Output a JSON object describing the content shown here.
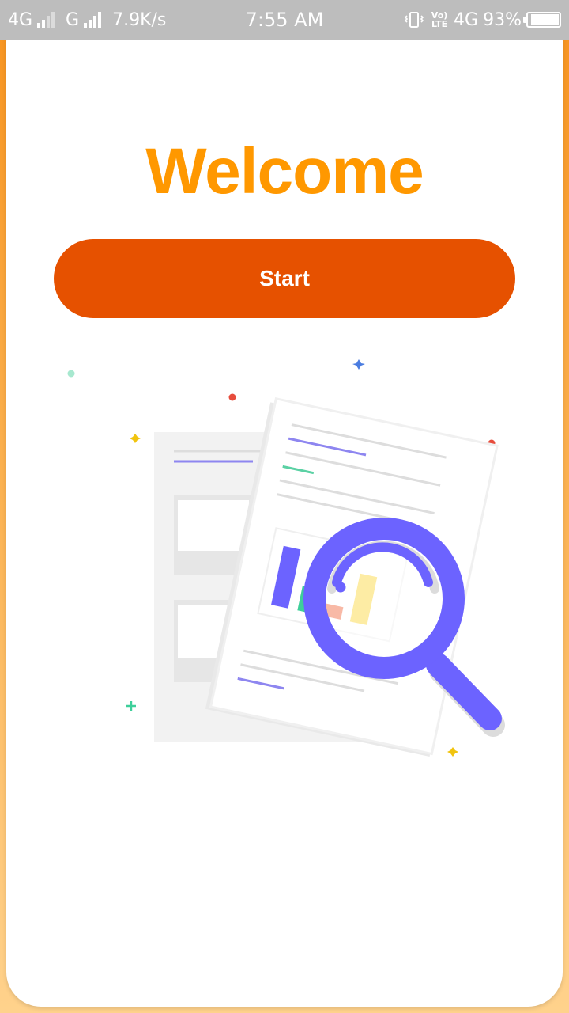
{
  "status_bar": {
    "network1": "4G",
    "network2": "G",
    "speed": "7.9K/s",
    "time": "7:55 AM",
    "volte": "Vo) LTE",
    "network3": "4G",
    "battery_percent": "93%",
    "battery_level": 0.93,
    "icons": [
      "signal-icon",
      "vibrate-icon",
      "battery-icon"
    ]
  },
  "welcome": {
    "title": "Welcome",
    "start_label": "Start"
  },
  "colors": {
    "title": "#ff9800",
    "button": "#e65100",
    "accent": "#6c63ff",
    "status_bar": "#bdbdbd"
  },
  "illustration": {
    "icons": [
      "document-icon",
      "magnifier-icon",
      "bar-chart-icon"
    ]
  }
}
